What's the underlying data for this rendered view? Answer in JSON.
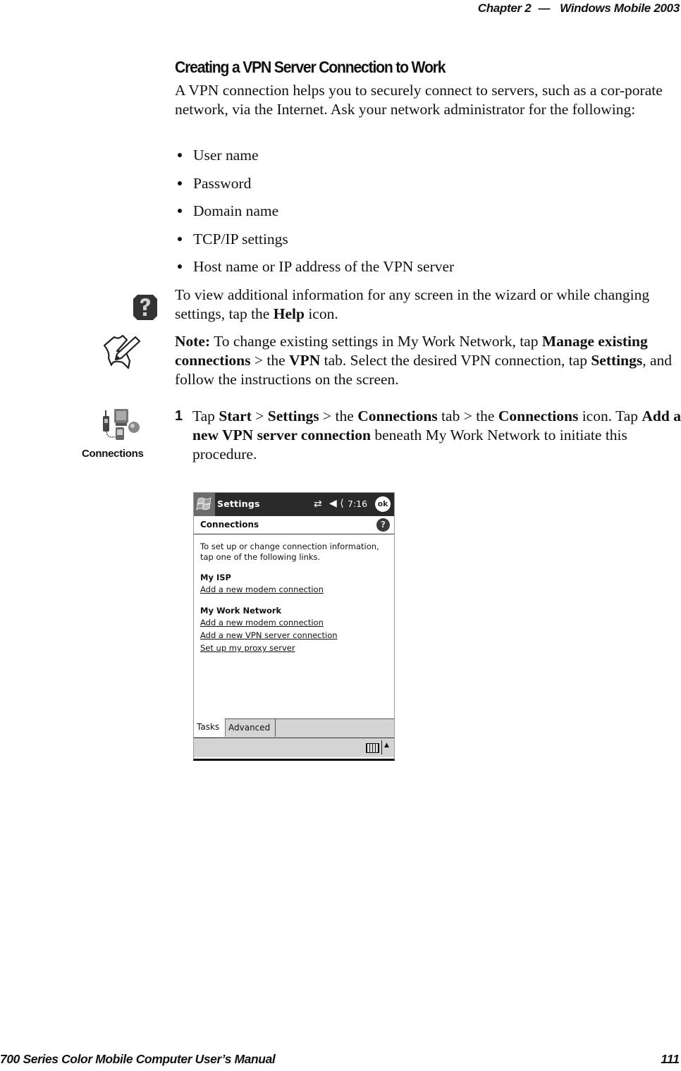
{
  "running_header": {
    "chapter": "Chapter  2",
    "separator": "—",
    "title": "Windows Mobile 2003"
  },
  "section": {
    "title": "Creating a VPN Server Connection to Work",
    "intro": "A VPN connection helps you to securely connect to servers, such as a cor-porate network, via the Internet. Ask your network administrator for the following:",
    "bullets": [
      "User name",
      "Password",
      "Domain name",
      "TCP/IP settings",
      "Host name or IP address of the VPN server"
    ]
  },
  "help_tip": {
    "icon": "help-icon",
    "text_before": "To view additional information for any screen in the wizard or while changing settings, tap the ",
    "bold": "Help",
    "text_after": " icon."
  },
  "note": {
    "icon": "note-pencil-icon",
    "label": "Note:",
    "t1": " To change existing settings in My Work Network, tap ",
    "b1": "Manage existing connections",
    "t2": " > the ",
    "b2": "VPN",
    "t3": " tab. Select the desired VPN connection, tap ",
    "b3": "Settings",
    "t4": ", and follow the instructions on the screen."
  },
  "step1": {
    "number": "1",
    "t1": "Tap ",
    "b1": "Start",
    "t2": " > ",
    "b2": "Settings",
    "t3": " > the ",
    "b3": "Connections",
    "t4": " tab > the ",
    "b4": "Connections",
    "t5": " icon. Tap ",
    "b5": "Add a new VPN server connection",
    "t6": " beneath My Work Network to initiate this procedure.",
    "icon_label": "Connections"
  },
  "ppc_screen": {
    "title": "Settings",
    "connectivity_icon": "⇄",
    "volume_icon": "◀ ⟨",
    "time": "7:16",
    "ok_label": "ok",
    "header": "Connections",
    "help_glyph": "?",
    "instructions": "To set up or change connection information, tap one of the following links.",
    "groups": [
      {
        "title": "My ISP",
        "links": [
          "Add a new modem connection"
        ]
      },
      {
        "title": "My Work Network",
        "links": [
          "Add a new modem connection",
          "Add a new VPN server connection",
          "Set up my proxy server"
        ]
      }
    ],
    "tabs": [
      "Tasks",
      "Advanced"
    ],
    "active_tab": "Tasks",
    "sip_arrow": "▲"
  },
  "footer": {
    "manual_title": "700 Series Color Mobile Computer User’s Manual",
    "page_number": "111"
  }
}
